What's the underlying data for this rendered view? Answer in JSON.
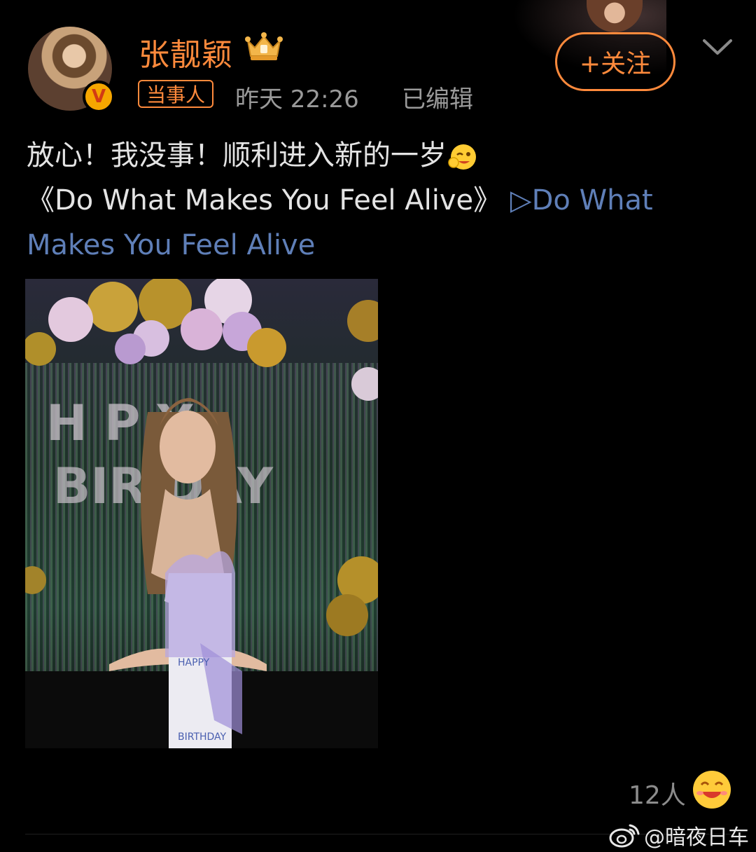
{
  "post": {
    "author_name": "张靓颖",
    "author_tag": "当事人",
    "time": "昨天 22:26",
    "edited": "已编辑",
    "follow_label": "+关注",
    "text_line1": "放心！我没事！顺利进入新的一岁",
    "text_line2_prefix": "《Do What Makes You Feel Alive》 ",
    "link_text_part1": "▷Do What",
    "link_text_part2": "Makes You Feel Alive",
    "likes": "12人",
    "verified_badge": "V"
  },
  "watermark": {
    "text": "@暗夜日车"
  },
  "icons": {
    "crown": "crown-icon",
    "chevron": "chevron-down-icon",
    "emoji_inline": "smiling-face-icon",
    "like_emoji": "laughing-face-icon",
    "weibo": "weibo-logo-icon"
  },
  "colors": {
    "accent": "#ff8a3c",
    "link": "#5f7fb8",
    "meta": "#9a9a9a",
    "background": "#000000"
  }
}
